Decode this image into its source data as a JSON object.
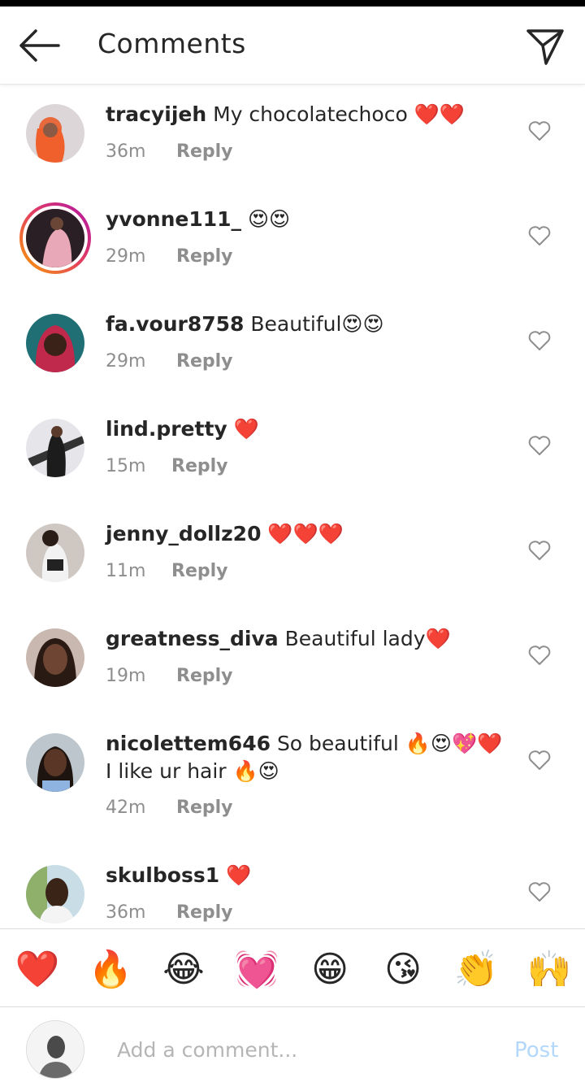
{
  "header": {
    "title": "Comments",
    "back_icon": "arrow-left-icon",
    "send_icon": "paper-plane-icon"
  },
  "comments": [
    {
      "user": "tracyijeh",
      "text": "My chocolatechoco ❤️❤️",
      "time": "36m",
      "reply": "Reply"
    },
    {
      "user": "yvonne111_",
      "text": "😍😍",
      "time": "29m",
      "reply": "Reply"
    },
    {
      "user": "fa.vour8758",
      "text": "Beautiful😍😍",
      "time": "29m",
      "reply": "Reply"
    },
    {
      "user": "lind.pretty",
      "text": "❤️",
      "time": "15m",
      "reply": "Reply"
    },
    {
      "user": "jenny_dollz20",
      "text": "❤️❤️❤️",
      "time": "11m",
      "reply": "Reply"
    },
    {
      "user": "greatness_diva",
      "text": "Beautiful lady❤️",
      "time": "19m",
      "reply": "Reply"
    },
    {
      "user": "nicolettem646",
      "text": "So  beautiful 🔥😍💖❤️I like ur hair 🔥😍",
      "time": "42m",
      "reply": "Reply"
    },
    {
      "user": "skulboss1",
      "text": "❤️",
      "time": "36m",
      "reply": "Reply"
    }
  ],
  "emoji_bar": [
    "❤️",
    "🔥",
    "😂",
    "💓",
    "😁",
    "😘",
    "👏",
    "🙌"
  ],
  "composer": {
    "placeholder": "Add a comment...",
    "post_label": "Post"
  },
  "colors": {
    "post_disabled": "#b3d8fb",
    "meta_gray": "#8e8e8e",
    "text": "#262626"
  }
}
